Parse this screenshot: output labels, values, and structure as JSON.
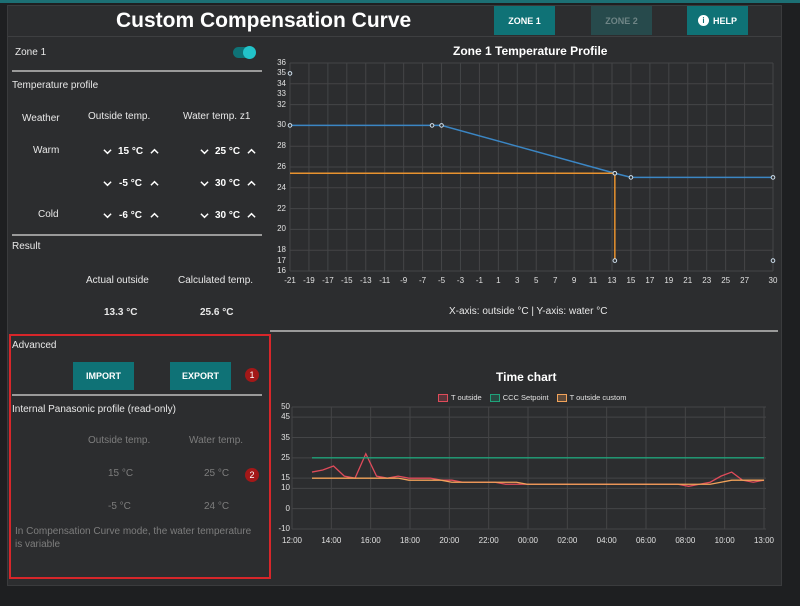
{
  "header": {
    "title": "Custom Compensation Curve",
    "zone1_label": "ZONE 1",
    "zone2_label": "ZONE 2",
    "help_label": "HELP"
  },
  "zone": {
    "label": "Zone 1",
    "enabled": true
  },
  "temperature_profile": {
    "heading": "Temperature profile",
    "col_weather": "Weather",
    "col_outside": "Outside temp.",
    "col_water": "Water temp. z1",
    "rows": [
      {
        "label": "Warm",
        "outside": "15 °C",
        "water": "25 °C"
      },
      {
        "label": "",
        "outside": "-5 °C",
        "water": "30 °C"
      },
      {
        "label": "Cold",
        "outside": "-6 °C",
        "water": "30 °C"
      }
    ]
  },
  "result": {
    "heading": "Result",
    "actual_label": "Actual outside",
    "calc_label": "Calculated temp.",
    "actual_value": "13.3 °C",
    "calc_value": "25.6 °C"
  },
  "advanced": {
    "heading": "Advanced",
    "import_label": "IMPORT",
    "export_label": "EXPORT",
    "badge1": "1",
    "internal_heading": "Internal Panasonic profile (read-only)",
    "col_outside": "Outside temp.",
    "col_water": "Water temp.",
    "rows": [
      {
        "outside": "15 °C",
        "water": "25 °C"
      },
      {
        "outside": "-5 °C",
        "water": "24 °C"
      }
    ],
    "badge2": "2",
    "note": "In Compensation Curve mode, the water temperature is variable"
  },
  "colors": {
    "accent": "#0f7276",
    "profile_line": "#3b86c4",
    "current_marker": "#e8922f",
    "t_outside": "#e04b5a",
    "ccc_setpoint": "#1fa37a",
    "t_outside_custom": "#f2a35a",
    "highlight_box": "#d7262a"
  },
  "chart_data": [
    {
      "type": "line",
      "title": "Zone 1 Temperature Profile",
      "caption": "X-axis: outside °C | Y-axis: water °C",
      "xlim": [
        -21,
        30
      ],
      "ylim": [
        16,
        36
      ],
      "x_ticks": [
        -21,
        -19,
        -17,
        -15,
        -13,
        -11,
        -9,
        -7,
        -5,
        -3,
        -1,
        1,
        3,
        5,
        7,
        9,
        11,
        13,
        15,
        17,
        19,
        21,
        23,
        25,
        27,
        30
      ],
      "y_ticks": [
        16,
        18,
        20,
        22,
        24,
        26,
        28,
        30,
        32,
        34,
        36
      ],
      "y_tick_labels_extra": [
        "35",
        "33",
        "17"
      ],
      "grid": true,
      "series": [
        {
          "points": [
            [
              -21,
              30
            ],
            [
              -6,
              30
            ],
            [
              -5,
              30
            ],
            [
              13.3,
              25.4
            ],
            [
              15,
              25
            ],
            [
              30,
              25
            ]
          ]
        }
      ],
      "current": {
        "x": 13.3,
        "y": 25.4
      },
      "extra_points": [
        [
          -21,
          35
        ],
        [
          30,
          17
        ]
      ]
    },
    {
      "type": "line",
      "title": "Time chart",
      "legend_position": "top-center",
      "x_labels": [
        "12:00",
        "14:00",
        "16:00",
        "18:00",
        "20:00",
        "22:00",
        "00:00",
        "02:00",
        "04:00",
        "06:00",
        "08:00",
        "10:00",
        "13:00"
      ],
      "y_ticks": [
        -10,
        0,
        10,
        15,
        25,
        35,
        45,
        50
      ],
      "ylim": [
        -10,
        50
      ],
      "grid": true,
      "series": [
        {
          "name": "T outside",
          "values": [
            18,
            19,
            21,
            16,
            15,
            27,
            16,
            15,
            16,
            15,
            15,
            15,
            14,
            14,
            13,
            13,
            13,
            13,
            12,
            12,
            12,
            12,
            12,
            12,
            12,
            12,
            12,
            12,
            12,
            12,
            12,
            12,
            12,
            12,
            12,
            11,
            12,
            13,
            16,
            18,
            14,
            13,
            14
          ]
        },
        {
          "name": "CCC Setpoint",
          "values": [
            25,
            25,
            25,
            25,
            25,
            25,
            25,
            25,
            25,
            25,
            25,
            25,
            25,
            25,
            25,
            25,
            25,
            25,
            25,
            25,
            25,
            25,
            25,
            25,
            25,
            25,
            25,
            25,
            25,
            25,
            25,
            25,
            25,
            25,
            25,
            25,
            25,
            25,
            25,
            25,
            25,
            25,
            25
          ]
        },
        {
          "name": "T outside custom",
          "values": [
            15,
            15,
            15,
            15,
            15,
            15,
            15,
            15,
            15,
            14,
            14,
            14,
            14,
            13,
            13,
            13,
            13,
            13,
            13,
            13,
            12,
            12,
            12,
            12,
            12,
            12,
            12,
            12,
            12,
            12,
            12,
            12,
            12,
            12,
            12,
            12,
            12,
            12,
            13,
            14,
            14,
            14,
            14
          ]
        }
      ]
    }
  ]
}
